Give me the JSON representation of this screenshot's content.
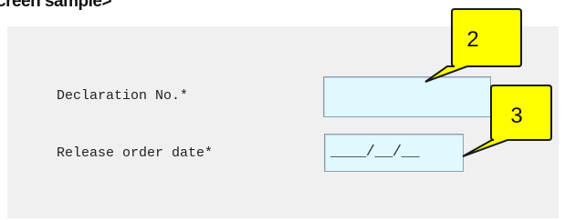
{
  "caption": "creen sample>",
  "form": {
    "declaration_label": "Declaration No.*",
    "declaration_value": "",
    "release_label": "Release order date*",
    "release_value": "____/__/__"
  },
  "callouts": {
    "first": "2",
    "second": "3"
  },
  "colors": {
    "panel_bg": "#f0f0f0",
    "field_bg": "#dff9ff",
    "callout_fill": "#ffff00",
    "callout_border": "#1a1a1a"
  }
}
